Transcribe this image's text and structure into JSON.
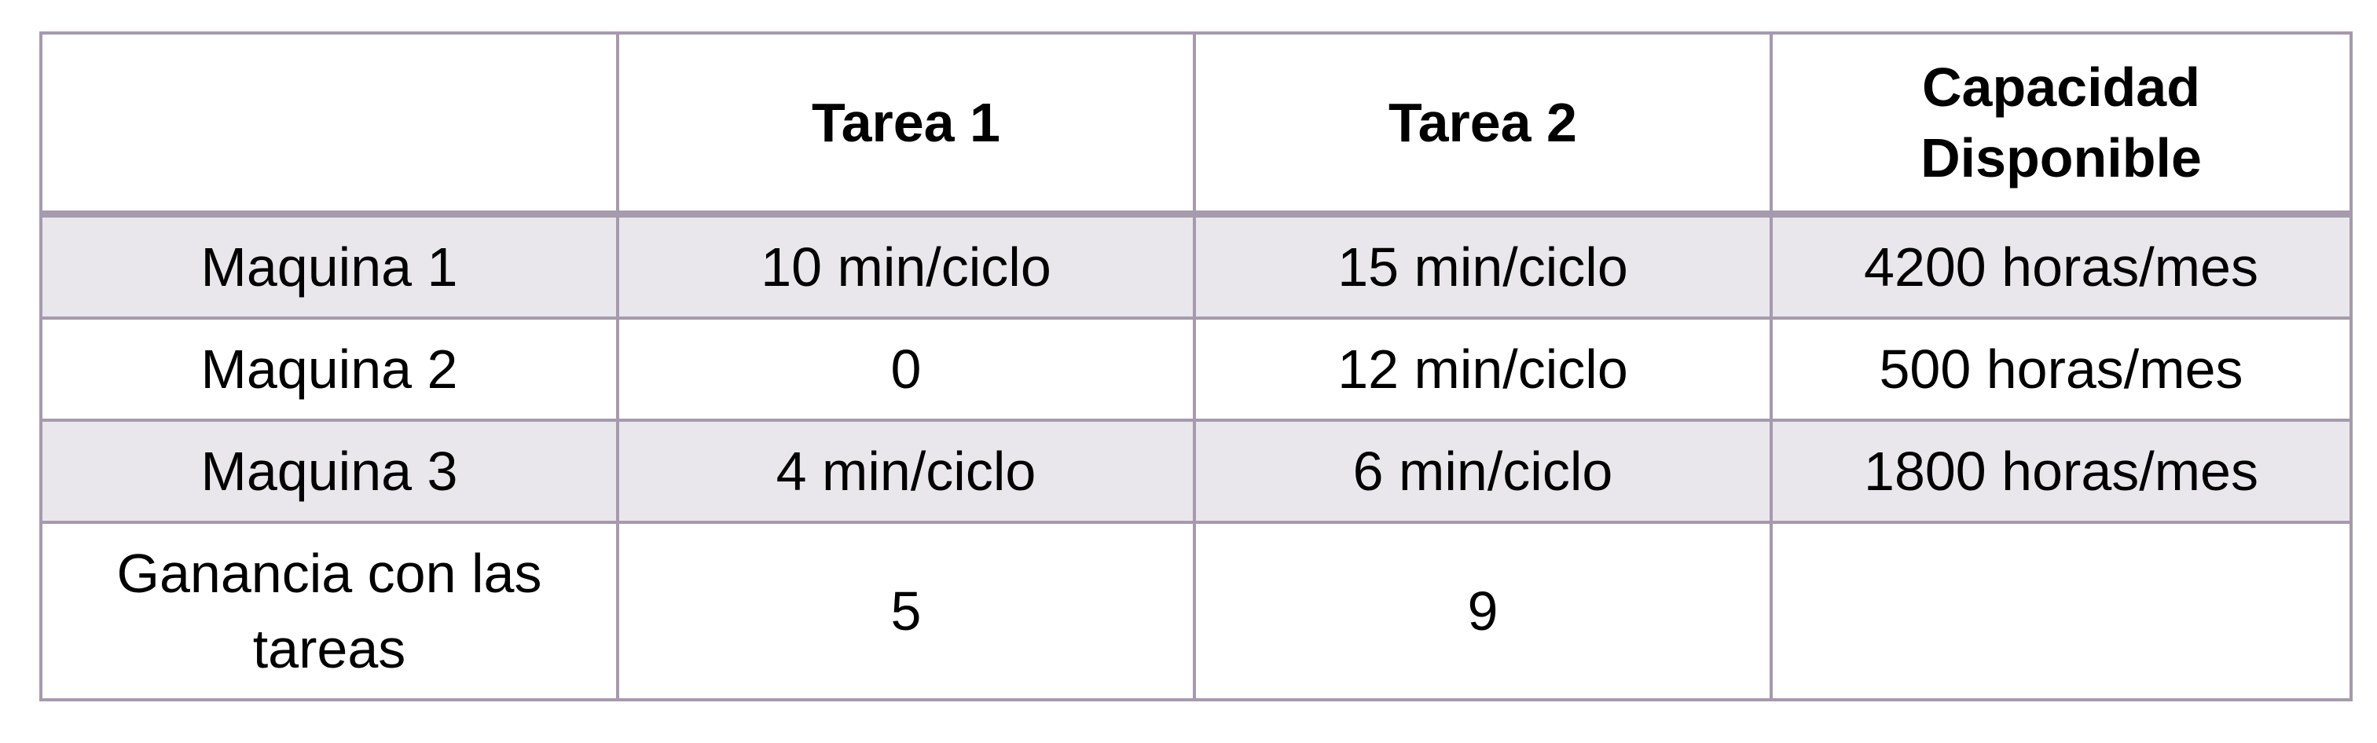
{
  "table": {
    "headers": [
      "",
      "Tarea 1",
      "Tarea 2",
      "Capacidad Disponible"
    ],
    "rows": [
      [
        "Maquina 1",
        "10 min/ciclo",
        "15 min/ciclo",
        "4200 horas/mes"
      ],
      [
        "Maquina 2",
        "0",
        "12 min/ciclo",
        "500 horas/mes"
      ],
      [
        "Maquina 3",
        "4 min/ciclo",
        "6 min/ciclo",
        "1800 horas/mes"
      ],
      [
        "Ganancia con las tareas",
        "5",
        "9",
        ""
      ]
    ]
  },
  "colors": {
    "border": "#a69aad",
    "shaded_row": "#e9e7ec",
    "background": "#ffffff",
    "text": "#000000"
  }
}
